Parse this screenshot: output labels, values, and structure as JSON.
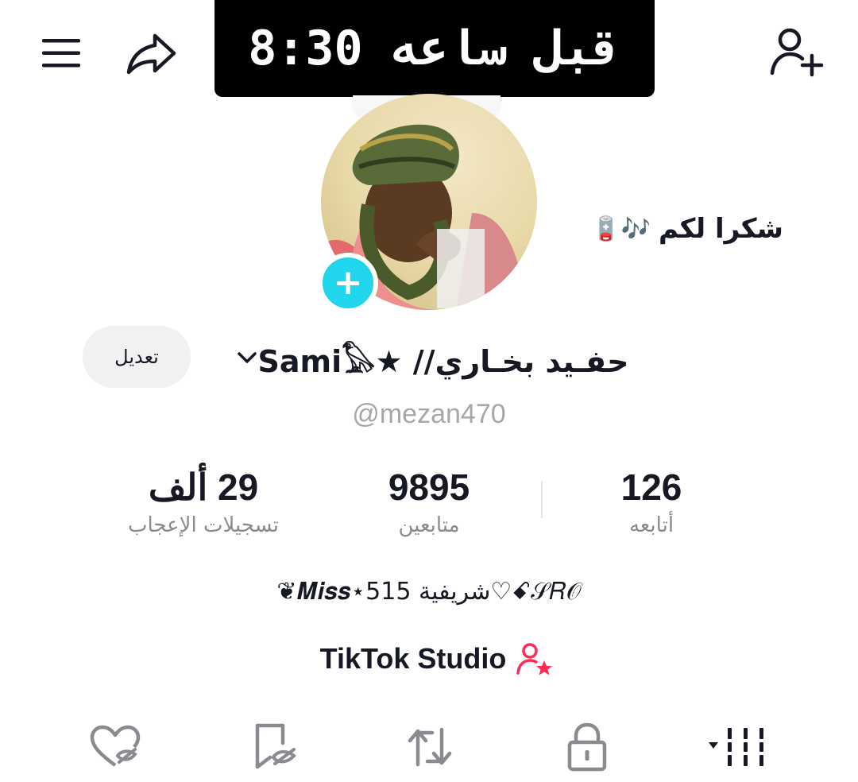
{
  "top_bar": {
    "menu_icon": "hamburger-menu-icon",
    "share_icon": "share-arrow-icon",
    "add_friend_icon": "person-add-icon",
    "time_banner": "قبل ساعه 8:30"
  },
  "profile": {
    "caption_bubble": {
      "text": "شكرا لكم",
      "emoji": "🪫🎶"
    },
    "avatar_add_label": "+",
    "edit_button": "تعديل",
    "nickname": "حفـيد بخـاري// ★Sami𓅃",
    "username": "@mezan470",
    "bio": "❦𝑴𝒊𝒔𝒔⋆515 شريفية♡ꗃ𝒮𝑅𝒪",
    "studio_label": "TikTok Studio"
  },
  "stats": {
    "following": {
      "value": "126",
      "label": "أتابعه"
    },
    "followers": {
      "value": "9895",
      "label": "متابعين"
    },
    "likes": {
      "value": "29 ألف",
      "label": "تسجيلات الإعجاب"
    }
  },
  "tabs": [
    {
      "icon": "liked-heart-hidden-icon"
    },
    {
      "icon": "favorites-bookmark-hidden-icon"
    },
    {
      "icon": "repost-arrows-icon"
    },
    {
      "icon": "lock-icon"
    },
    {
      "icon": "video-grid-dropdown-icon"
    }
  ],
  "colors": {
    "accent_cyan": "#20d5ec",
    "studio_pink": "#fe2c55",
    "text_primary": "#161823",
    "text_secondary": "#8a8b91"
  }
}
